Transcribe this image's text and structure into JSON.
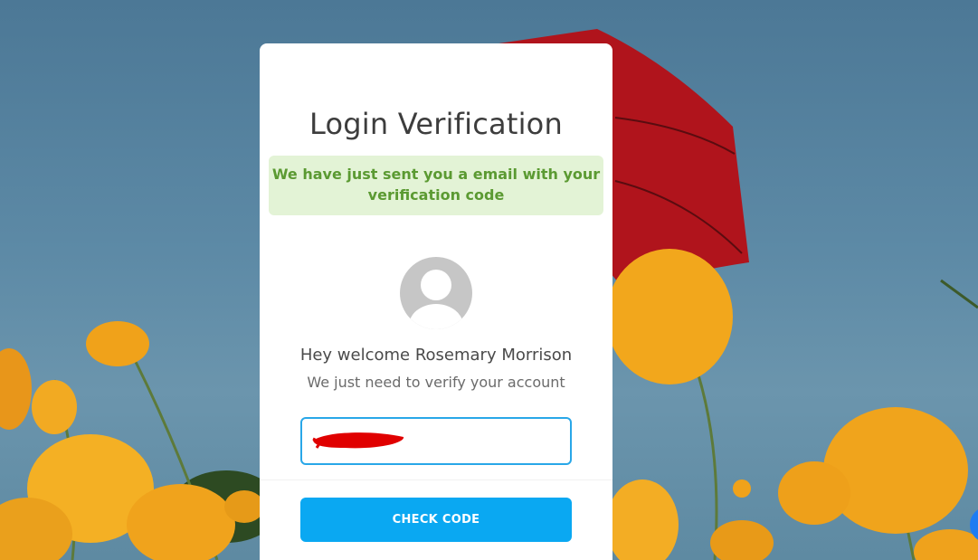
{
  "login": {
    "title": "Login Verification",
    "alert_message": "We have just sent you a email with your verification code",
    "welcome_text": "Hey welcome Rosemary Morrison",
    "subtext": "We just need to verify your account",
    "code_value": "",
    "check_button_label": "CHECK CODE"
  },
  "colors": {
    "alert_bg": "#e3f3d6",
    "alert_text": "#5b9a32",
    "button": "#0aa8f2",
    "input_border": "#29a7e8",
    "redaction": "#e00000"
  },
  "icons": {
    "avatar": "user-placeholder-icon"
  }
}
